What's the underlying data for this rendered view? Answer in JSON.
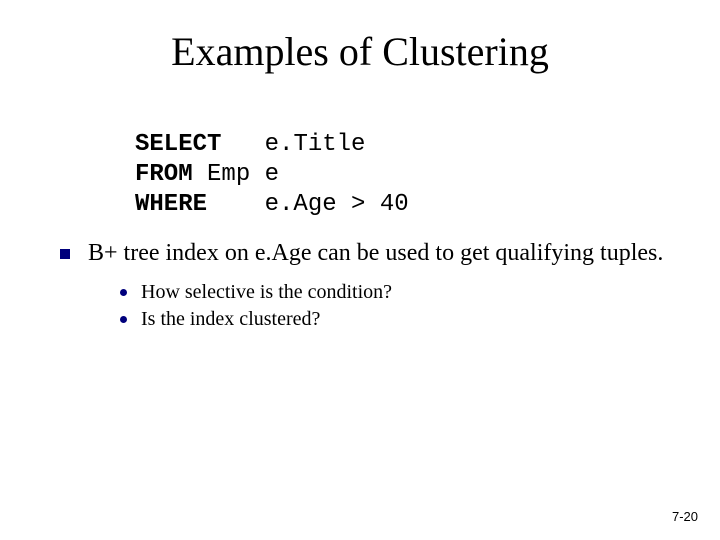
{
  "title": "Examples of Clustering",
  "sql": {
    "kw_select": "SELECT",
    "select_expr": "e.Title",
    "kw_from": "FROM",
    "from_expr": "Emp e",
    "kw_where": "WHERE",
    "where_expr": "e.Age > 40"
  },
  "bullets": {
    "main": "B+ tree index on e.Age can be used to get qualifying tuples.",
    "sub1": "How selective is the condition?",
    "sub2": "Is the index clustered?"
  },
  "page_number": "7-20"
}
